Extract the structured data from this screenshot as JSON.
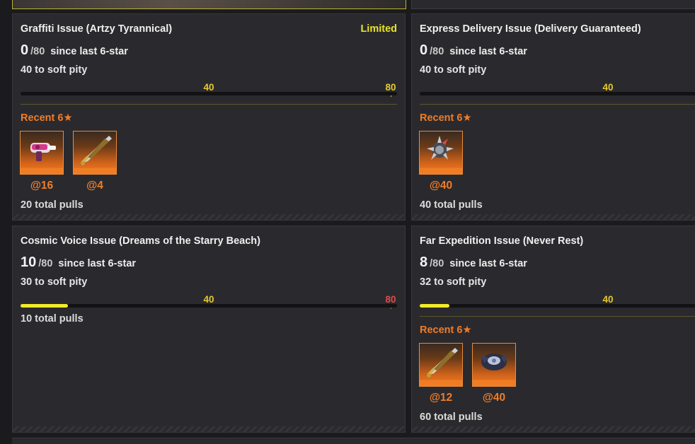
{
  "cards": [
    {
      "title": "Graffiti Issue (Artzy Tyrannical)",
      "badge": "Limited",
      "count": "0",
      "max": "/80",
      "since": "since last 6-star",
      "soft": "40 to soft pity",
      "progress": 0,
      "marker1": "40",
      "marker2": "80",
      "recent_label": "Recent 6★",
      "items": [
        {
          "pull": "@16",
          "icon": "pink-blaster-weapon-icon"
        },
        {
          "pull": "@4",
          "icon": "golden-greatsword-icon"
        }
      ],
      "total": "20 total pulls"
    },
    {
      "title": "Express Delivery Issue (Delivery Guaranteed)",
      "count": "0",
      "max": "/80",
      "since": "since last 6-star",
      "soft": "40 to soft pity",
      "progress": 0,
      "marker1": "40",
      "recent_label": "Recent 6★",
      "items": [
        {
          "pull": "@40",
          "icon": "spiked-gauntlet-icon"
        }
      ],
      "total": "40 total pulls"
    },
    {
      "title": "Cosmic Voice Issue (Dreams of the Starry Beach)",
      "count": "10",
      "max": "/80",
      "since": "since last 6-star",
      "soft": "30 to soft pity",
      "progress": 0.125,
      "marker1": "40",
      "marker2": "80",
      "total": "10 total pulls"
    },
    {
      "title": "Far Expedition Issue (Never Rest)",
      "count": "8",
      "max": "/80",
      "since": "since last 6-star",
      "soft": "32 to soft pity",
      "progress": 0.1,
      "marker1": "40",
      "recent_label": "Recent 6★",
      "items": [
        {
          "pull": "@12",
          "icon": "golden-greatsword-icon"
        },
        {
          "pull": "@40",
          "icon": "dark-orb-weapon-icon"
        }
      ],
      "total": "60 total pulls"
    }
  ],
  "colors": {
    "accent_orange": "#f07c27",
    "limited_yellow": "#e8e327",
    "progress_yellow": "#f0ec2a",
    "hard_pity_red": "#e24a4a"
  }
}
